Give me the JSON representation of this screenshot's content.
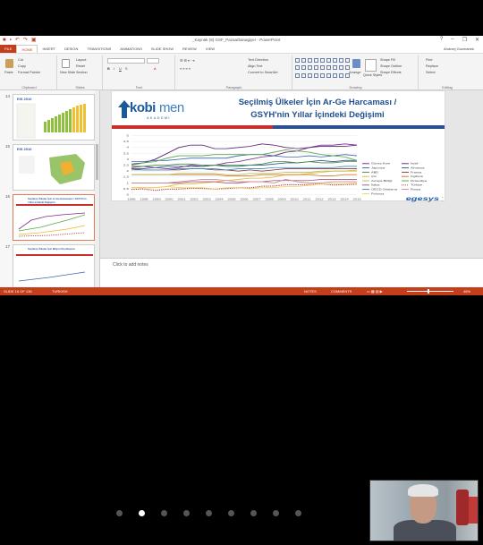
{
  "window": {
    "title": "_Kaynak (8) GSF_Pazaarbanagiyer - PowerPoint",
    "controls": [
      "?",
      "–",
      "❐",
      "✕"
    ]
  },
  "ribbon_tabs": [
    "FILE",
    "HOME",
    "INSERT",
    "DESIGN",
    "TRANSITIONS",
    "ANIMATIONS",
    "SLIDE SHOW",
    "REVIEW",
    "VIEW"
  ],
  "user_name": "Andrzej Guzmanek",
  "ribbon": {
    "clipboard": {
      "paste": "Paste",
      "cut": "Cut",
      "copy": "Copy",
      "format_painter": "Format Painter",
      "label": "Clipboard"
    },
    "slides": {
      "new_slide": "New Slide",
      "layout": "Layout",
      "reset": "Reset",
      "section": "Section",
      "label": "Slides"
    },
    "font": {
      "label": "Font"
    },
    "paragraph": {
      "text_direction": "Text Direction",
      "align_text": "Align Text",
      "smartart": "Convert to SmartArt",
      "label": "Paragraph"
    },
    "drawing": {
      "arrange": "Arrange",
      "quick_styles": "Quick Styles",
      "shape_fill": "Shape Fill",
      "shape_outline": "Shape Outline",
      "shape_effects": "Shape Effects",
      "label": "Drawing"
    },
    "editing": {
      "find": "Find",
      "replace": "Replace",
      "select": "Select",
      "label": "Editing"
    }
  },
  "thumbnails": [
    {
      "num": "14",
      "title": "EIS 2010"
    },
    {
      "num": "15",
      "title": "EIS 2010"
    },
    {
      "num": "16",
      "title": "Seçilmiş Ülkeler İçin Ar-Ge Harcaması / GSYH'nin Yıllar İçindeki Değişimi"
    },
    {
      "num": "17",
      "title": "Seçilmiş Ülkeler İçin Milyon Kişi Başına"
    }
  ],
  "slide": {
    "logo_kobi": "kobi",
    "logo_men": "men",
    "logo_akademi": "AKADEMİ",
    "title_line1": "Seçilmiş Ülkeler İçin Ar-Ge Harcaması /",
    "title_line2": "GSYH'nin Yıllar İçindeki Değişimi",
    "brand": "egesys"
  },
  "notes_placeholder": "Click to add notes",
  "status": {
    "slide_info": "SLIDE 16 OF 136",
    "language": "TURKISH",
    "notes": "NOTES",
    "comments": "COMMENTS",
    "zoom": "46%"
  },
  "video": {
    "page_dots": 9,
    "active_dot": 1
  },
  "chart_data": {
    "type": "line",
    "x": [
      1996,
      1997,
      1998,
      1999,
      2000,
      2001,
      2002,
      2003,
      2004,
      2005,
      2006,
      2007,
      2008,
      2009,
      2010,
      2011,
      2012,
      2013,
      2014,
      2015
    ],
    "x_tick_labels": [
      "1996",
      "1998",
      "1999",
      "2000",
      "2001",
      "2002",
      "2003",
      "2004",
      "2005",
      "2006",
      "2007",
      "2008",
      "2009",
      "2010",
      "2011",
      "2012",
      "2013",
      "2014",
      "2015"
    ],
    "ylim": [
      0,
      5
    ],
    "y_ticks": [
      "0",
      "0,5",
      "1",
      "1,5",
      "2",
      "2,5",
      "3",
      "3,5",
      "4",
      "4,5",
      "5"
    ],
    "grid": true,
    "legend_position": "right",
    "series": [
      {
        "name": "Güney Kore",
        "color": "#7a2a8c",
        "values": [
          2.3,
          2.4,
          2.3,
          2.2,
          2.3,
          2.5,
          2.4,
          2.5,
          2.7,
          2.8,
          3.0,
          3.2,
          3.3,
          3.6,
          3.7,
          4.0,
          4.2,
          4.2,
          4.3,
          4.2
        ]
      },
      {
        "name": "İsrail",
        "color": "#5e2a7a",
        "values": [
          2.6,
          2.7,
          3.0,
          3.5,
          4.0,
          4.2,
          4.2,
          3.9,
          3.9,
          4.0,
          4.1,
          4.3,
          4.2,
          4.0,
          3.9,
          4.0,
          4.1,
          4.1,
          4.1,
          4.2
        ]
      },
      {
        "name": "Japonya",
        "color": "#3a66b0",
        "values": [
          2.8,
          2.8,
          2.9,
          2.9,
          3.0,
          3.1,
          3.1,
          3.1,
          3.1,
          3.3,
          3.4,
          3.4,
          3.3,
          3.2,
          3.2,
          3.3,
          3.2,
          3.3,
          3.4,
          3.3
        ]
      },
      {
        "name": "Almanya",
        "color": "#2f5f8a",
        "values": [
          2.2,
          2.2,
          2.3,
          2.4,
          2.4,
          2.4,
          2.4,
          2.5,
          2.4,
          2.4,
          2.5,
          2.5,
          2.6,
          2.7,
          2.7,
          2.8,
          2.9,
          2.8,
          2.9,
          2.9
        ]
      },
      {
        "name": "ABD",
        "color": "#4a8a4a",
        "values": [
          2.4,
          2.4,
          2.5,
          2.5,
          2.6,
          2.6,
          2.5,
          2.5,
          2.5,
          2.5,
          2.5,
          2.6,
          2.8,
          2.8,
          2.7,
          2.8,
          2.7,
          2.7,
          2.8,
          2.8
        ]
      },
      {
        "name": "Fransa",
        "color": "#8a3a3a",
        "values": [
          2.2,
          2.1,
          2.1,
          2.1,
          2.1,
          2.2,
          2.2,
          2.1,
          2.1,
          2.0,
          2.1,
          2.0,
          2.1,
          2.2,
          2.2,
          2.2,
          2.2,
          2.2,
          2.2,
          2.2
        ]
      },
      {
        "name": "Çin",
        "color": "#e8b830",
        "values": [
          0.6,
          0.6,
          0.6,
          0.7,
          0.9,
          0.9,
          1.0,
          1.1,
          1.2,
          1.3,
          1.4,
          1.4,
          1.5,
          1.7,
          1.7,
          1.8,
          1.9,
          2.0,
          2.0,
          2.1
        ]
      },
      {
        "name": "İngiltere",
        "color": "#d07a30",
        "values": [
          1.7,
          1.7,
          1.7,
          1.7,
          1.7,
          1.7,
          1.7,
          1.7,
          1.6,
          1.6,
          1.6,
          1.7,
          1.7,
          1.7,
          1.7,
          1.7,
          1.6,
          1.6,
          1.7,
          1.7
        ]
      },
      {
        "name": "Avrupa Birliği",
        "color": "#b8c060",
        "values": [
          1.7,
          1.7,
          1.7,
          1.7,
          1.8,
          1.8,
          1.8,
          1.8,
          1.7,
          1.7,
          1.8,
          1.8,
          1.8,
          1.9,
          1.9,
          1.9,
          2.0,
          2.0,
          2.0,
          2.0
        ]
      },
      {
        "name": "Finlandiya",
        "color": "#5aa84a",
        "values": [
          2.5,
          2.7,
          2.8,
          3.1,
          3.3,
          3.3,
          3.3,
          3.4,
          3.4,
          3.4,
          3.4,
          3.4,
          3.6,
          3.8,
          3.7,
          3.6,
          3.4,
          3.3,
          3.2,
          2.9
        ]
      },
      {
        "name": "İtalya",
        "color": "#a05a8a",
        "values": [
          1.0,
          1.0,
          1.0,
          1.0,
          1.0,
          1.1,
          1.1,
          1.1,
          1.0,
          1.0,
          1.1,
          1.1,
          1.2,
          1.2,
          1.2,
          1.2,
          1.3,
          1.3,
          1.3,
          1.3
        ]
      },
      {
        "name": "Türkiye",
        "color": "#b03030",
        "values": [
          0.45,
          0.49,
          0.37,
          0.47,
          0.48,
          0.54,
          0.53,
          0.48,
          0.52,
          0.59,
          0.58,
          0.72,
          0.73,
          0.85,
          0.84,
          0.86,
          0.92,
          0.82,
          0.86,
          0.88
        ]
      },
      {
        "name": "OECD Ortalama",
        "color": "#3a8ac0",
        "values": [
          2.1,
          2.1,
          2.1,
          2.1,
          2.2,
          2.2,
          2.2,
          2.2,
          2.1,
          2.2,
          2.2,
          2.2,
          2.3,
          2.3,
          2.3,
          2.3,
          2.3,
          2.3,
          2.4,
          2.4
        ]
      },
      {
        "name": "Rusya",
        "color": "#d08a90",
        "values": [
          1.0,
          1.0,
          1.0,
          1.0,
          1.1,
          1.2,
          1.3,
          1.3,
          1.2,
          1.1,
          1.1,
          1.1,
          1.0,
          1.3,
          1.1,
          1.0,
          1.0,
          1.1,
          1.1,
          1.1
        ]
      },
      {
        "name": "Polonya",
        "color": "#f0d060",
        "values": [
          0.6,
          0.6,
          0.6,
          0.7,
          0.6,
          0.6,
          0.6,
          0.5,
          0.6,
          0.6,
          0.5,
          0.6,
          0.6,
          0.7,
          0.7,
          0.8,
          0.9,
          0.9,
          0.9,
          1.0
        ]
      }
    ]
  }
}
